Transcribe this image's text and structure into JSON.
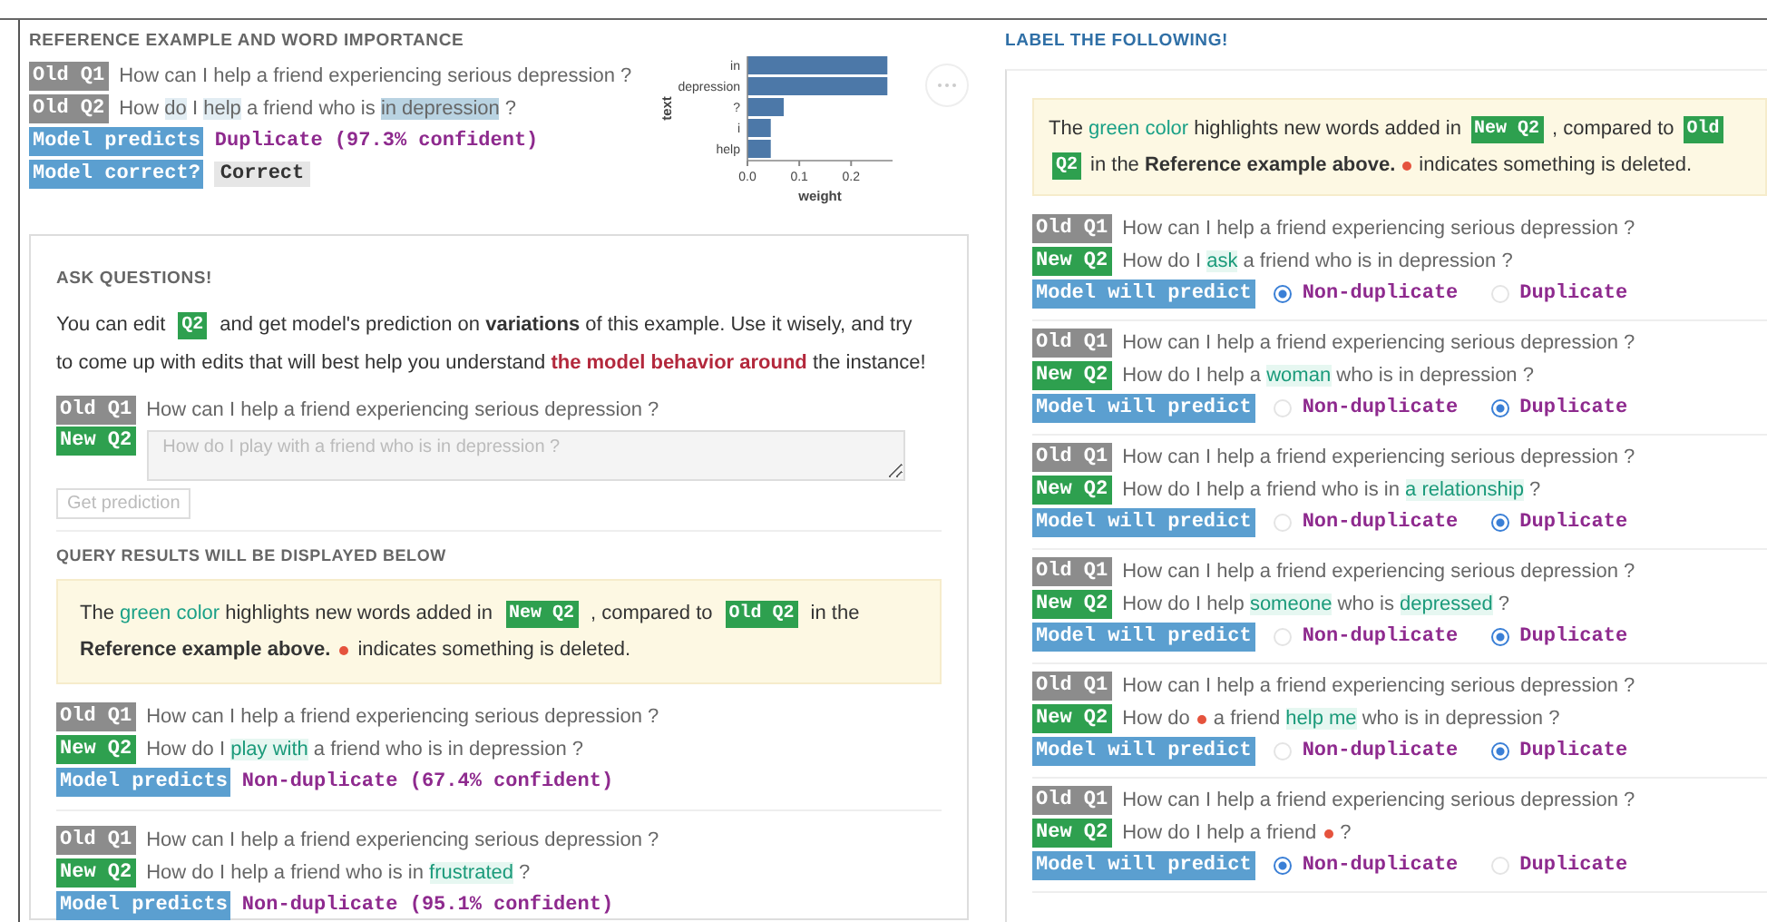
{
  "reference": {
    "title": "REFERENCE EXAMPLE AND WORD IMPORTANCE",
    "questions": [
      {
        "tag": "Old Q1",
        "kind": "old",
        "segments": [
          {
            "text": "How can I help a friend experiencing serious depression ?",
            "kind": "plain"
          }
        ]
      },
      {
        "tag": "Old Q2",
        "kind": "old",
        "segments": [
          {
            "text": "How ",
            "kind": "plain"
          },
          {
            "text": "do",
            "kind": "faint"
          },
          {
            "text": " I ",
            "kind": "plain"
          },
          {
            "text": "help",
            "kind": "faint"
          },
          {
            "text": " a friend who is ",
            "kind": "plain"
          },
          {
            "text": "in depression",
            "kind": "strong"
          },
          {
            "text": " ?",
            "kind": "plain"
          }
        ]
      }
    ],
    "prediction": {
      "tag": "Model predicts",
      "value": "Duplicate (97.3% confident)"
    },
    "correctness": {
      "tag": "Model correct?",
      "value": "Correct"
    },
    "chart_data": {
      "type": "bar",
      "orientation": "horizontal",
      "xlabel": "weight",
      "ylabel": "text",
      "categories": [
        "in",
        "depression",
        "?",
        "i",
        "help"
      ],
      "values": [
        0.27,
        0.27,
        0.07,
        0.045,
        0.045
      ],
      "xlim": [
        0,
        0.28
      ],
      "xticks": [
        {
          "value": 0,
          "label": "0.0"
        },
        {
          "value": 0.1,
          "label": "0.1"
        },
        {
          "value": 0.2,
          "label": "0.2"
        }
      ]
    }
  },
  "ask": {
    "title": "ASK QUESTIONS!",
    "intro": [
      {
        "text": "You can edit ",
        "kind": "plain"
      },
      {
        "text": "Q2",
        "kind": "tag"
      },
      {
        "text": "  and get model's prediction on ",
        "kind": "plain"
      },
      {
        "text": "variations",
        "kind": "bold"
      },
      {
        "text": " of this example. Use it wisely, and try",
        "kind": "plain"
      },
      {
        "text": "to come up with edits that will best help you understand ",
        "kind": "plain",
        "line_start": true
      },
      {
        "text": "the model behavior around",
        "kind": "red"
      },
      {
        "text": " the instance!",
        "kind": "plain"
      }
    ],
    "old_question": {
      "tag": "Old Q1",
      "text": "How can I help a friend experiencing serious depression ?"
    },
    "new_question": {
      "tag": "New Q2",
      "placeholder": "How do I play with a friend who is in depression ?"
    },
    "button": {
      "label": "Get prediction",
      "disabled": true
    },
    "results_title": "QUERY RESULTS WILL BE DISPLAYED BELOW",
    "note": [
      {
        "text": "The ",
        "kind": "plain"
      },
      {
        "text": "green color",
        "kind": "green"
      },
      {
        "text": " highlights new words added in ",
        "kind": "plain"
      },
      {
        "text": "New Q2",
        "kind": "tag"
      },
      {
        "text": "  , compared to ",
        "kind": "plain"
      },
      {
        "text": "Old Q2",
        "kind": "tag"
      },
      {
        "text": "  in the",
        "kind": "plain"
      },
      {
        "text": "Reference example above.",
        "kind": "bold",
        "line_start": true
      },
      {
        "kind": "deleted"
      },
      {
        "text": " indicates something is deleted.",
        "kind": "plain"
      }
    ],
    "results": [
      {
        "questions": [
          {
            "tag": "Old Q1",
            "kind": "old",
            "segments": [
              {
                "text": "How can I help a friend experiencing serious depression ?",
                "kind": "plain"
              }
            ]
          },
          {
            "tag": "New Q2",
            "kind": "new",
            "segments": [
              {
                "text": "How do I ",
                "kind": "plain"
              },
              {
                "text": "play with",
                "kind": "added"
              },
              {
                "text": " a friend who is in depression ?",
                "kind": "plain"
              }
            ]
          }
        ],
        "prediction": {
          "tag": "Model predicts",
          "value": "Non-duplicate (67.4% confident)"
        }
      },
      {
        "questions": [
          {
            "tag": "Old Q1",
            "kind": "old",
            "segments": [
              {
                "text": "How can I help a friend experiencing serious depression ?",
                "kind": "plain"
              }
            ]
          },
          {
            "tag": "New Q2",
            "kind": "new",
            "segments": [
              {
                "text": "How do I help a friend who is in ",
                "kind": "plain"
              },
              {
                "text": "frustrated",
                "kind": "added"
              },
              {
                "text": " ?",
                "kind": "plain"
              }
            ]
          }
        ],
        "prediction": {
          "tag": "Model predicts",
          "value": "Non-duplicate (95.1% confident)"
        }
      }
    ]
  },
  "label": {
    "title": "LABEL THE FOLLOWING!",
    "note": [
      {
        "text": "The ",
        "kind": "plain"
      },
      {
        "text": "green color",
        "kind": "green"
      },
      {
        "text": " highlights new words added in ",
        "kind": "plain"
      },
      {
        "text": "New Q2",
        "kind": "tag"
      },
      {
        "text": "  , compared to ",
        "kind": "plain"
      },
      {
        "text": "Old",
        "kind": "tag"
      },
      {
        "text": "Q2",
        "kind": "tag",
        "line_start": true
      },
      {
        "text": "  in the ",
        "kind": "plain"
      },
      {
        "text": "Reference example above.",
        "kind": "bold"
      },
      {
        "kind": "deleted"
      },
      {
        "text": " indicates something is deleted.",
        "kind": "plain"
      }
    ],
    "items": [
      {
        "questions": [
          {
            "tag": "Old Q1",
            "kind": "old",
            "segments": [
              {
                "text": "How can I help a friend experiencing serious depression ?",
                "kind": "plain"
              }
            ]
          },
          {
            "tag": "New Q2",
            "kind": "new",
            "segments": [
              {
                "text": "How do I ",
                "kind": "plain"
              },
              {
                "text": "ask",
                "kind": "added"
              },
              {
                "text": " a friend who is in depression ?",
                "kind": "plain"
              }
            ]
          }
        ],
        "prompt": "Model will predict",
        "options": [
          {
            "label": "Non-duplicate",
            "selected": true
          },
          {
            "label": "Duplicate",
            "selected": false
          }
        ]
      },
      {
        "questions": [
          {
            "tag": "Old Q1",
            "kind": "old",
            "segments": [
              {
                "text": "How can I help a friend experiencing serious depression ?",
                "kind": "plain"
              }
            ]
          },
          {
            "tag": "New Q2",
            "kind": "new",
            "segments": [
              {
                "text": "How do I help a ",
                "kind": "plain"
              },
              {
                "text": "woman",
                "kind": "added"
              },
              {
                "text": " who is in depression ?",
                "kind": "plain"
              }
            ]
          }
        ],
        "prompt": "Model will predict",
        "options": [
          {
            "label": "Non-duplicate",
            "selected": false
          },
          {
            "label": "Duplicate",
            "selected": true
          }
        ]
      },
      {
        "questions": [
          {
            "tag": "Old Q1",
            "kind": "old",
            "segments": [
              {
                "text": "How can I help a friend experiencing serious depression ?",
                "kind": "plain"
              }
            ]
          },
          {
            "tag": "New Q2",
            "kind": "new",
            "segments": [
              {
                "text": "How do I help a friend who is in ",
                "kind": "plain"
              },
              {
                "text": "a relationship",
                "kind": "added"
              },
              {
                "text": " ?",
                "kind": "plain"
              }
            ]
          }
        ],
        "prompt": "Model will predict",
        "options": [
          {
            "label": "Non-duplicate",
            "selected": false
          },
          {
            "label": "Duplicate",
            "selected": true
          }
        ]
      },
      {
        "questions": [
          {
            "tag": "Old Q1",
            "kind": "old",
            "segments": [
              {
                "text": "How can I help a friend experiencing serious depression ?",
                "kind": "plain"
              }
            ]
          },
          {
            "tag": "New Q2",
            "kind": "new",
            "segments": [
              {
                "text": "How do I help ",
                "kind": "plain"
              },
              {
                "text": "someone",
                "kind": "added"
              },
              {
                "text": " who is ",
                "kind": "plain"
              },
              {
                "text": "depressed",
                "kind": "added"
              },
              {
                "text": " ?",
                "kind": "plain"
              }
            ]
          }
        ],
        "prompt": "Model will predict",
        "options": [
          {
            "label": "Non-duplicate",
            "selected": false
          },
          {
            "label": "Duplicate",
            "selected": true
          }
        ]
      },
      {
        "questions": [
          {
            "tag": "Old Q1",
            "kind": "old",
            "segments": [
              {
                "text": "How can I help a friend experiencing serious depression ?",
                "kind": "plain"
              }
            ]
          },
          {
            "tag": "New Q2",
            "kind": "new",
            "segments": [
              {
                "text": "How do ",
                "kind": "plain"
              },
              {
                "kind": "deleted"
              },
              {
                "text": "a friend ",
                "kind": "plain"
              },
              {
                "text": "help me",
                "kind": "added"
              },
              {
                "text": " who is in depression ?",
                "kind": "plain"
              }
            ]
          }
        ],
        "prompt": "Model will predict",
        "options": [
          {
            "label": "Non-duplicate",
            "selected": false
          },
          {
            "label": "Duplicate",
            "selected": true
          }
        ]
      },
      {
        "questions": [
          {
            "tag": "Old Q1",
            "kind": "old",
            "segments": [
              {
                "text": "How can I help a friend experiencing serious depression ?",
                "kind": "plain"
              }
            ]
          },
          {
            "tag": "New Q2",
            "kind": "new",
            "segments": [
              {
                "text": "How do I help a friend ",
                "kind": "plain"
              },
              {
                "kind": "deleted"
              },
              {
                "text": "?",
                "kind": "plain"
              }
            ]
          }
        ],
        "prompt": "Model will predict",
        "options": [
          {
            "label": "Non-duplicate",
            "selected": true
          },
          {
            "label": "Duplicate",
            "selected": false
          }
        ]
      }
    ]
  }
}
